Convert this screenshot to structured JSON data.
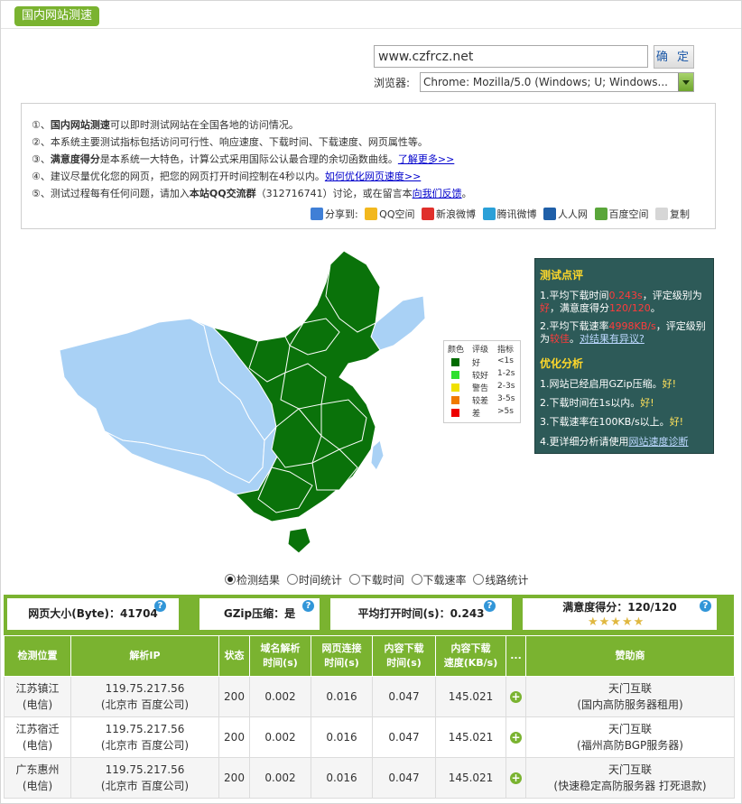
{
  "header": {
    "title": "国内网站测速"
  },
  "form": {
    "url_value": "www.czfrcz.net",
    "confirm_label": "确 定",
    "browser_label": "浏览器:",
    "browser_value": "Chrome: Mozilla/5.0 (Windows; U; Windows..."
  },
  "info": {
    "item1_num": "①、",
    "item1_bold": "国内网站测速",
    "item1_text": "可以即时测试网站在全国各地的访问情况。",
    "item2": "②、本系统主要测试指标包括访问可行性、响应速度、下载时间、下载速度、网页属性等。",
    "item3_num": "③、",
    "item3_bold": "满意度得分",
    "item3_text": "是本系统一大特色，计算公式采用国际公认最合理的余切函数曲线。",
    "item3_link": "了解更多>>",
    "item4_text": "④、建议尽量优化您的网页，把您的网页打开时间控制在4秒以内。",
    "item4_link": "如何优化网页速度>>",
    "item5_text1": "⑤、测试过程每有任何问题，请加入",
    "item5_bold": "本站QQ交流群",
    "item5_text2": "（312716741）讨论，或在留言本",
    "item5_link": "向我们反馈",
    "item5_end": "。",
    "share_label": "分享到:",
    "share_items": [
      "QQ空间",
      "新浪微博",
      "腾讯微博",
      "人人网",
      "百度空间",
      "复制"
    ]
  },
  "legend": {
    "headers": [
      "颜色",
      "评级",
      "指标"
    ],
    "rows": [
      {
        "label": "好",
        "range": "<1s",
        "color": "#006b00"
      },
      {
        "label": "较好",
        "range": "1-2s",
        "color": "#2ee02e"
      },
      {
        "label": "警告",
        "range": "2-3s",
        "color": "#f0e000"
      },
      {
        "label": "较差",
        "range": "3-5s",
        "color": "#f07a00"
      },
      {
        "label": "差",
        "range": ">5s",
        "color": "#ee0000"
      }
    ]
  },
  "evaluation": {
    "title": "测试点评",
    "p1_a": "1.平均下载时间",
    "p1_val": "0.243s",
    "p1_b": "，评定级别为",
    "p1_rating": "好",
    "p1_c": "，满意度得分",
    "p1_score": "120/120",
    "p1_d": "。",
    "p2_a": "2.平均下载速率",
    "p2_val": "4998KB/s",
    "p2_b": "，评定级别为",
    "p2_rating": "较佳",
    "p2_c": "。",
    "p2_link": "对结果有异议?",
    "opt_title": "优化分析",
    "o1": "1.网站已经启用GZip压缩。",
    "o1_good": "好!",
    "o2": "2.下载时间在1s以内。",
    "o2_good": "好!",
    "o3": "3.下载速率在100KB/s以上。",
    "o3_good": "好!",
    "o4": "4.更详细分析请使用",
    "o4_link": "网站速度诊断"
  },
  "tabs": [
    "检测结果",
    "时间统计",
    "下载时间",
    "下载速率",
    "线路统计"
  ],
  "stats": {
    "page_size": "网页大小(Byte)：41704",
    "gzip": "GZip压缩：是",
    "avg_time": "平均打开时间(s)：0.243",
    "score": "满意度得分：120/120",
    "help_mark": "?",
    "stars": 5
  },
  "table": {
    "headers": [
      "检测位置",
      "解析IP",
      "状态",
      "域名解析\n时间(s)",
      "网页连接\n时间(s)",
      "内容下载\n时间(s)",
      "内容下载\n速度(KB/s)",
      "...",
      "赞助商"
    ],
    "rows": [
      {
        "loc1": "江苏镇江",
        "loc2": "(电信)",
        "ip": "119.75.217.56",
        "ipinfo": "(北京市 百度公司)",
        "status": "200",
        "dns": "0.002",
        "conn": "0.016",
        "dl": "0.047",
        "speed": "145.021",
        "sp1": "天门互联",
        "sp2": "(国内高防服务器租用)"
      },
      {
        "loc1": "江苏宿迁",
        "loc2": "(电信)",
        "ip": "119.75.217.56",
        "ipinfo": "(北京市 百度公司)",
        "status": "200",
        "dns": "0.002",
        "conn": "0.016",
        "dl": "0.047",
        "speed": "145.021",
        "sp1": "天门互联",
        "sp2": "(福州高防BGP服务器)"
      },
      {
        "loc1": "广东惠州",
        "loc2": "(电信)",
        "ip": "119.75.217.56",
        "ipinfo": "(北京市 百度公司)",
        "status": "200",
        "dns": "0.002",
        "conn": "0.016",
        "dl": "0.047",
        "speed": "145.021",
        "sp1": "天门互联",
        "sp2": "(快速稳定高防服务器 打死退款)"
      }
    ]
  }
}
